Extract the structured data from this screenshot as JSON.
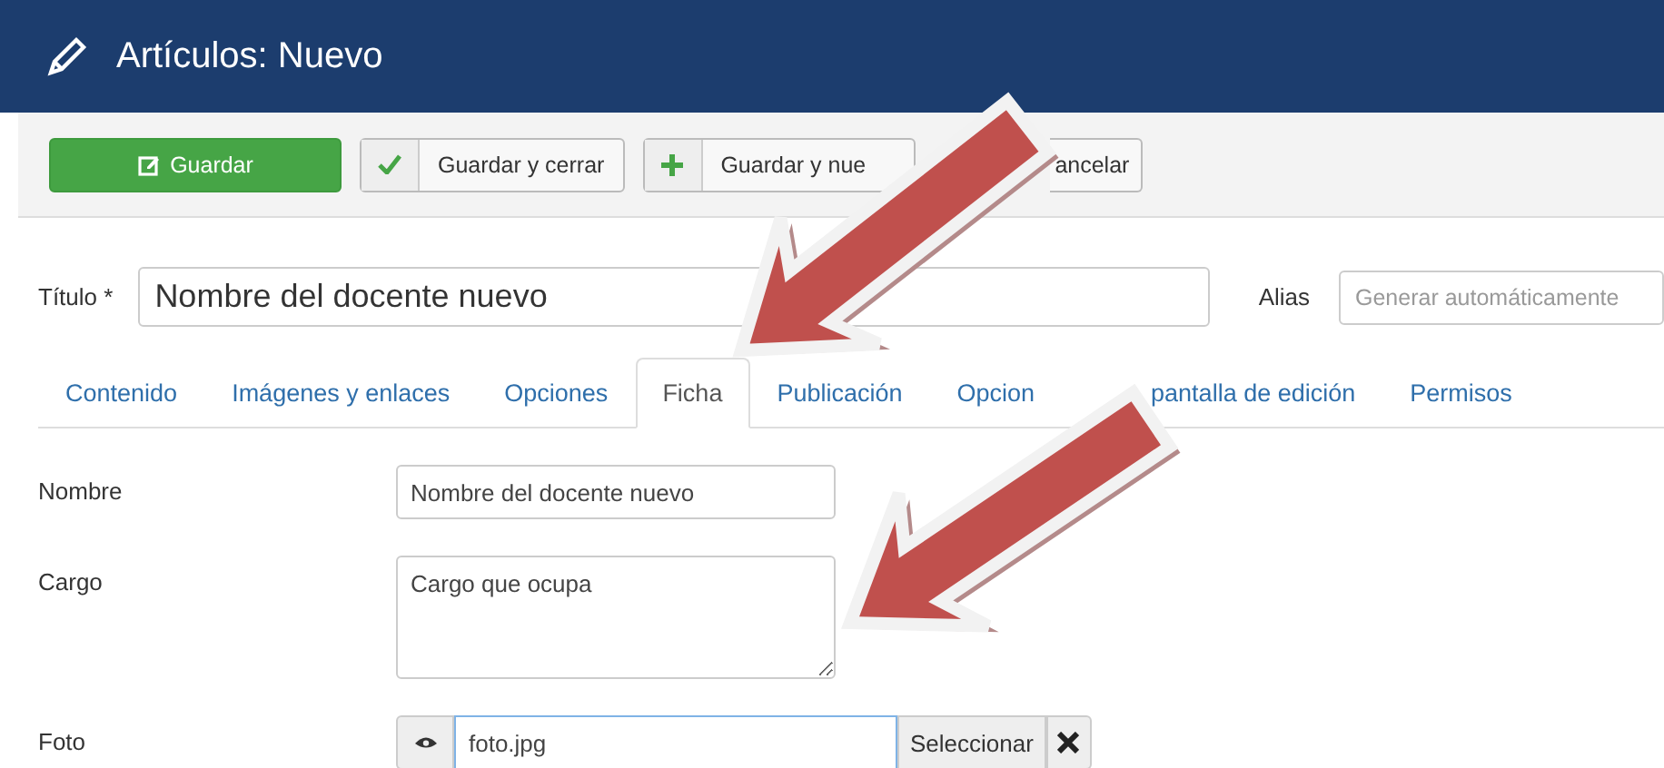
{
  "header": {
    "title": "Artículos: Nuevo"
  },
  "toolbar": [
    {
      "kind": "primary",
      "label": "Guardar"
    },
    {
      "kind": "check",
      "label": "Guardar y cerrar"
    },
    {
      "kind": "plus",
      "label": "Guardar y nue"
    },
    {
      "kind": "cut",
      "label": "ancelar"
    }
  ],
  "title_field": {
    "label": "Título *",
    "value": "Nombre del docente nuevo"
  },
  "alias_field": {
    "label": "Alias",
    "placeholder": "Generar automáticamente"
  },
  "tabs": [
    {
      "label_parts": [
        "Contenido"
      ],
      "selected": false
    },
    {
      "label_parts": [
        "Imágenes y enlaces"
      ],
      "selected": false
    },
    {
      "label_parts": [
        "Opciones"
      ],
      "selected": false
    },
    {
      "label_parts": [
        "Ficha"
      ],
      "selected": true
    },
    {
      "label_parts": [
        "Publicación"
      ],
      "selected": false
    },
    {
      "label_parts": [
        "Opcion",
        "pantalla de edición"
      ],
      "selected": false
    },
    {
      "label_parts": [
        "Permisos"
      ],
      "selected": false
    }
  ],
  "fields": [
    {
      "kind": "text",
      "label": "Nombre",
      "value": "Nombre del docente nuevo"
    },
    {
      "kind": "textarea",
      "label": "Cargo",
      "value": "Cargo que ocupa"
    },
    {
      "kind": "media",
      "label": "Foto",
      "value": "foto.jpg",
      "button": "Seleccionar"
    }
  ]
}
